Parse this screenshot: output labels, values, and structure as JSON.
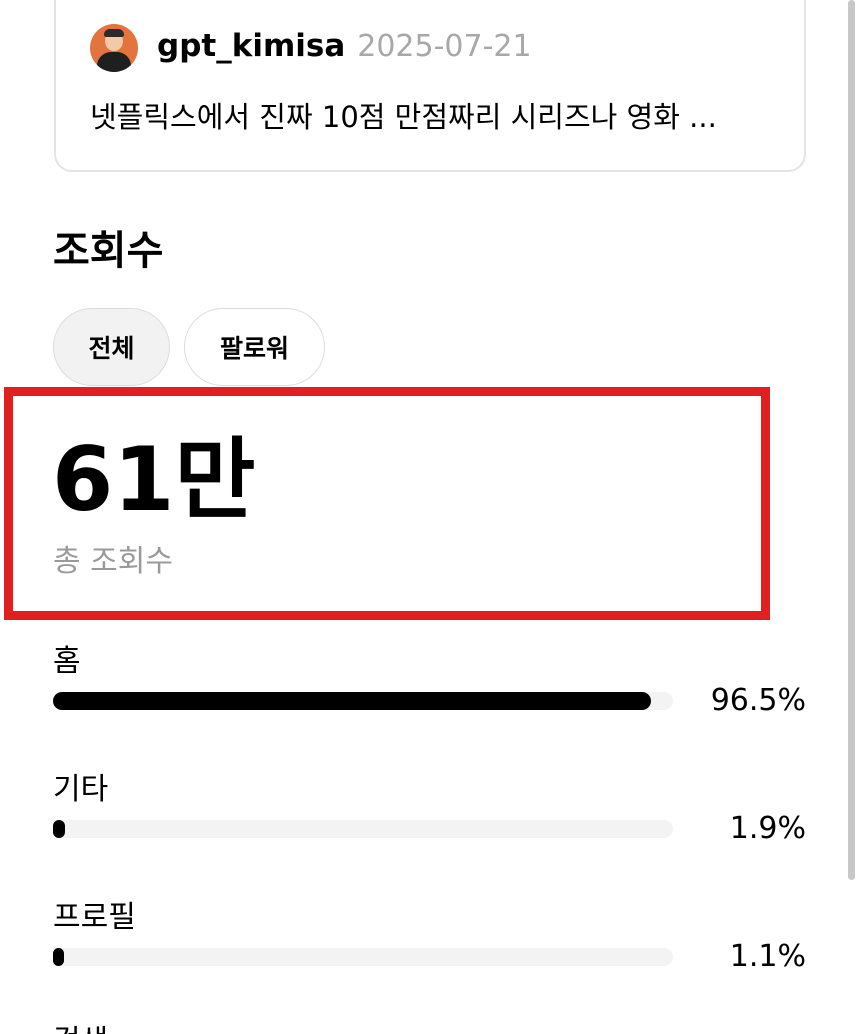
{
  "post": {
    "author": "gpt_kimisa",
    "date": "2025-07-21",
    "snippet": "넷플릭스에서 진짜 10점 만점짜리 시리즈나 영화 ..."
  },
  "views": {
    "title": "조회수",
    "tabs": [
      {
        "label": "전체",
        "active": true
      },
      {
        "label": "팔로워",
        "active": false
      }
    ],
    "total_value": "61만",
    "total_label": "총 조회수",
    "sources": [
      {
        "label": "홈",
        "percent_text": "96.5%",
        "percent": 96.5
      },
      {
        "label": "기타",
        "percent_text": "1.9%",
        "percent": 1.9
      },
      {
        "label": "프로필",
        "percent_text": "1.1%",
        "percent": 1.1
      },
      {
        "label": "검색"
      }
    ]
  },
  "colors": {
    "highlight_border": "#e02020",
    "bar_fill": "#000000",
    "bar_track": "#f3f3f3",
    "muted_text": "#9a9a9a"
  }
}
